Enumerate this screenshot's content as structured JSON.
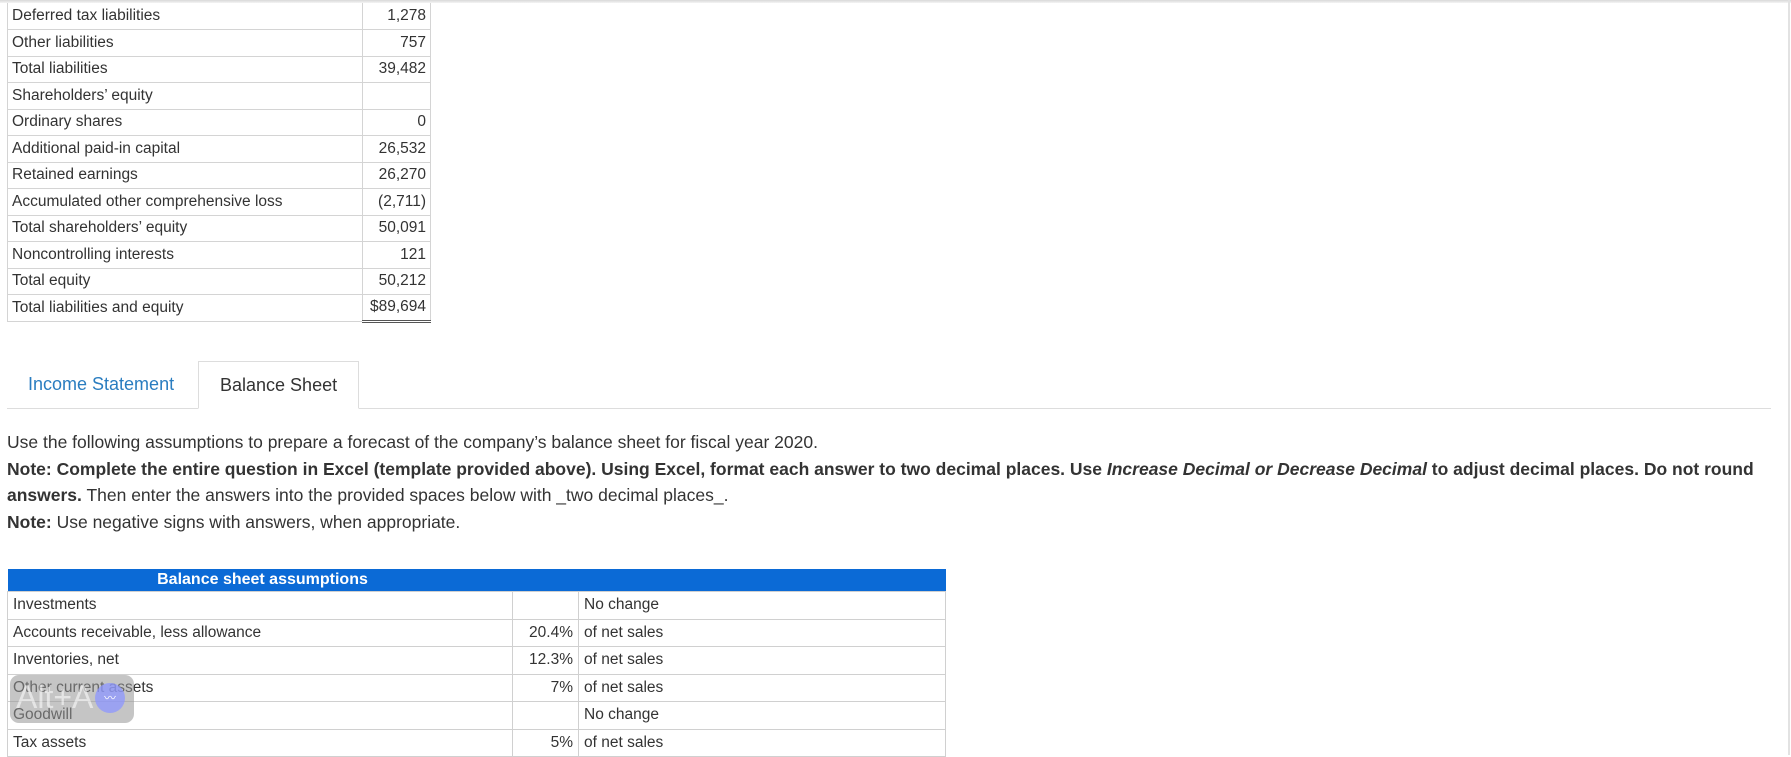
{
  "balance_sheet_fragment": {
    "rows": [
      {
        "label": "Deferred tax liabilities",
        "value": "1,278"
      },
      {
        "label": "Other liabilities",
        "value": "757"
      },
      {
        "label": "Total liabilities",
        "value": "39,482"
      },
      {
        "label": "Shareholders’ equity",
        "value": ""
      },
      {
        "label": "Ordinary shares",
        "value": "0"
      },
      {
        "label": "Additional paid-in capital",
        "value": "26,532"
      },
      {
        "label": "Retained earnings",
        "value": "26,270"
      },
      {
        "label": "Accumulated other comprehensive loss",
        "value": "(2,711)"
      },
      {
        "label": "Total shareholders’ equity",
        "value": "50,091"
      },
      {
        "label": "Noncontrolling interests",
        "value": "121"
      },
      {
        "label": "Total equity",
        "value": "50,212"
      },
      {
        "label": "Total liabilities and equity",
        "value": "$89,694"
      }
    ]
  },
  "tabs": [
    {
      "label": "Income Statement",
      "active": false
    },
    {
      "label": "Balance Sheet",
      "active": true
    }
  ],
  "instructions": {
    "line1": "Use the following assumptions to prepare a forecast of the company’s balance sheet for fiscal year 2020.",
    "note1_bold_a": "Note: Complete the entire question in Excel (template provided above). Using Excel, format each answer to two decimal places. Use ",
    "note1_italic": "Increase Decimal or Decrease Decimal",
    "note1_bold_b": " to adjust decimal places. Do not round answers.",
    "note1_plain": " Then enter the answers into the provided spaces below with _two decimal places_.",
    "note2_bold": "Note:",
    "note2_plain": " Use negative signs with answers, when appropriate."
  },
  "assumptions": {
    "header": "Balance sheet assumptions",
    "rows": [
      {
        "label": "Investments",
        "pct": "",
        "desc": "No change"
      },
      {
        "label": "Accounts receivable, less allowance",
        "pct": "20.4%",
        "desc": "of net sales"
      },
      {
        "label": "Inventories, net",
        "pct": "12.3%",
        "desc": "of net sales"
      },
      {
        "label": "Other current assets",
        "pct": "7%",
        "desc": "of net sales"
      },
      {
        "label": "Goodwill",
        "pct": "",
        "desc": "No change"
      },
      {
        "label": "Tax assets",
        "pct": "5%",
        "desc": "of net sales"
      }
    ]
  },
  "overlay": {
    "shortcut": "Alt+A",
    "icon": "audio-wave-icon"
  }
}
